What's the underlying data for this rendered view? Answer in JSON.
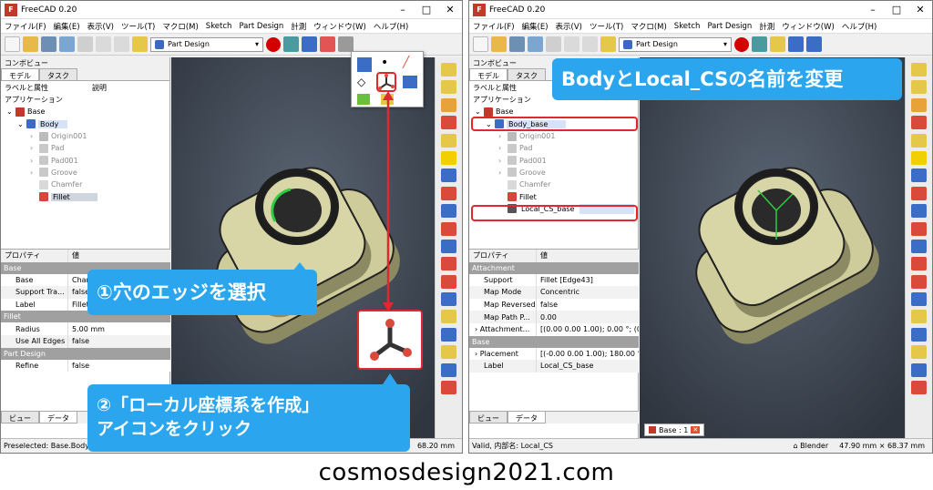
{
  "app_title": "FreeCAD 0.20",
  "menu": [
    "ファイル(F)",
    "編集(E)",
    "表示(V)",
    "ツール(T)",
    "マクロ(M)",
    "Sketch",
    "Part Design",
    "計測",
    "ウィンドウ(W)",
    "ヘルプ(H)"
  ],
  "toolbar": {
    "workbench": "Part Design",
    "record_icon": "macro-record-icon"
  },
  "combo_view_title": "コンボビュー",
  "tabs": [
    "モデル",
    "タスク"
  ],
  "tree_header": {
    "label_col": "ラベルと属性",
    "desc_col": "説明"
  },
  "tree_root": "アプリケーション",
  "left_window": {
    "tree": [
      "Base",
      "Body",
      "Origin001",
      "Pad",
      "Pad001",
      "Groove",
      "Chamfer",
      "Fillet"
    ],
    "prop_header": {
      "name": "プロパティ",
      "value": "値"
    },
    "groups": [
      {
        "name": "Base",
        "rows": [
          {
            "k": "Base",
            "v": "Cham"
          },
          {
            "k": "Support Tra...",
            "v": "false"
          },
          {
            "k": "Label",
            "v": "Fillet"
          }
        ]
      },
      {
        "name": "Fillet",
        "rows": [
          {
            "k": "Radius",
            "v": "5.00 mm"
          },
          {
            "k": "Use All Edges",
            "v": "false"
          }
        ]
      },
      {
        "name": "Part Design",
        "rows": [
          {
            "k": "Refine",
            "v": "false"
          }
        ]
      }
    ],
    "bottom_tabs": [
      "ビュー",
      "データ"
    ],
    "status_left": "Preselected: Base.Body.Fillet",
    "status_right": "68.20 mm"
  },
  "right_window": {
    "tree": [
      "Base",
      "Body_base",
      "Origin001",
      "Pad",
      "Pad001",
      "Groove",
      "Chamfer",
      "Fillet",
      "Local_CS_base"
    ],
    "prop_header": {
      "name": "プロパティ",
      "value": "値"
    },
    "groups": [
      {
        "name": "Attachment",
        "rows": [
          {
            "k": "Support",
            "v": "Fillet [Edge43]"
          },
          {
            "k": "Map Mode",
            "v": "Concentric"
          },
          {
            "k": "Map Reversed",
            "v": "false"
          },
          {
            "k": "Map Path P...",
            "v": "0.00"
          },
          {
            "k": "Attachment...",
            "v": "[(0.00 0.00 1.00); 0.00 °; (0.0..."
          }
        ]
      },
      {
        "name": "Base",
        "rows": [
          {
            "k": "Placement",
            "v": "[(-0.00 0.00 1.00); 180.00 °; (..."
          },
          {
            "k": "Label",
            "v": "Local_CS_base"
          }
        ]
      }
    ],
    "bottom_tabs": [
      "ビュー",
      "データ"
    ],
    "doc_tab": "Base : 1",
    "status_left": "Valid, 内部名: Local_CS",
    "nav_style": "Blender",
    "status_right": "47.90 mm × 68.37 mm"
  },
  "callouts": {
    "step1": "①穴のエッジを選択",
    "step2_line1": "②「ローカル座標系を作成」",
    "step2_line2": "アイコンをクリック",
    "rename": "BodyとLocal_CSの名前を変更"
  },
  "footer": "cosmosdesign2021.com",
  "colors": {
    "accent": "#2ba6ee",
    "highlight": "#e0282e",
    "viewport": "#323944",
    "model": "#cfcc9c",
    "edge": "#2ecc40"
  }
}
